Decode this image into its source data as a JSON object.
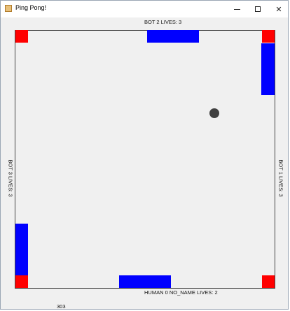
{
  "window": {
    "title": "Ping Pong!",
    "minimize_icon": "minimize-icon",
    "maximize_icon": "maximize-icon",
    "close_label": "✕"
  },
  "players": {
    "top": "BOT 2  LIVES: 3",
    "right": "BOT 1  LIVES: 3",
    "left": "BOT 3  LIVES: 3",
    "bottom": "HUMAN 0 NO_NAME LIVES: 2"
  },
  "footer": {
    "counter": "303"
  },
  "colors": {
    "corner": "#ff0000",
    "paddle": "#0000ff",
    "ball": "#404040",
    "background": "#f0f0f0"
  }
}
